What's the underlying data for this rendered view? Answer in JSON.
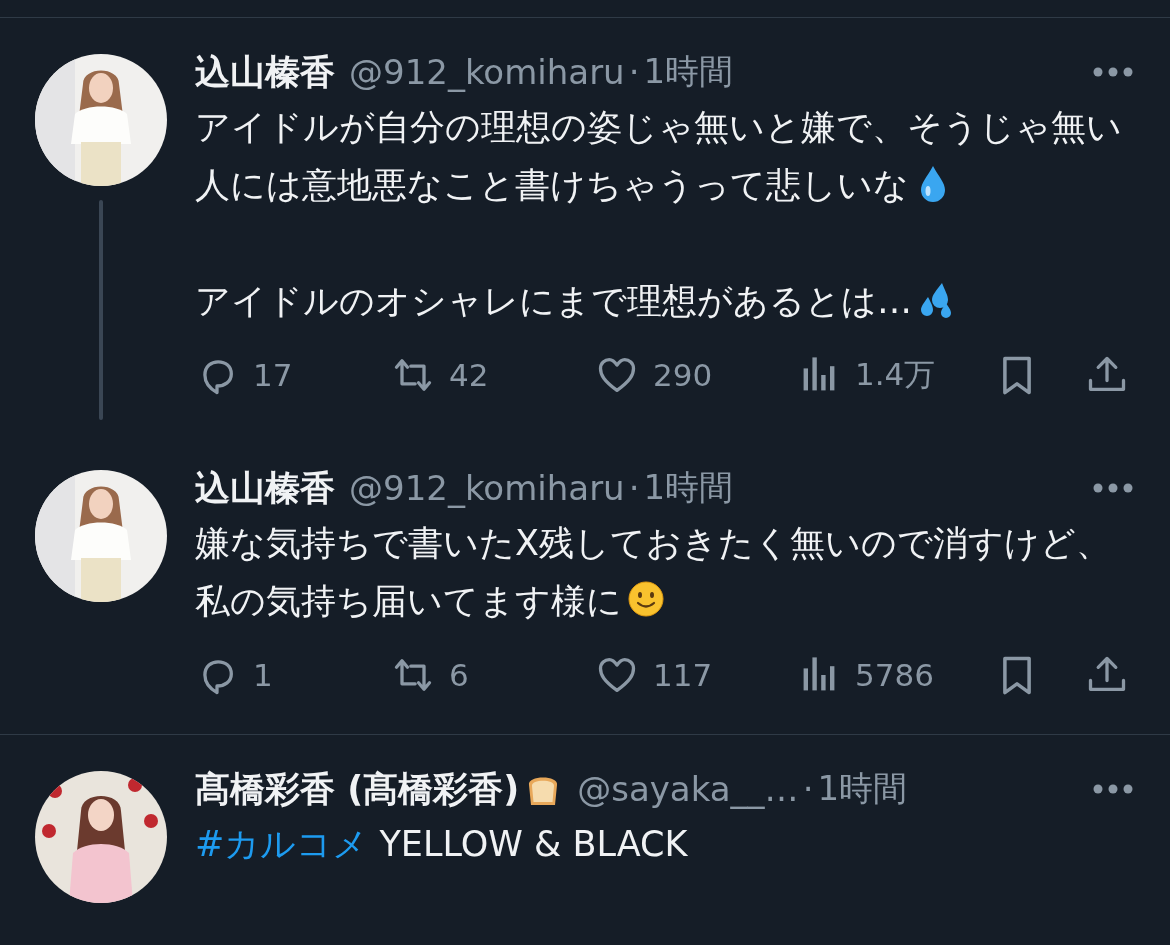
{
  "tweets": [
    {
      "name": "込山榛香",
      "handle": "@912_komiharu",
      "separator": "·",
      "time": "1時間",
      "thread_continues": true,
      "body": [
        {
          "segments": [
            {
              "kind": "text",
              "text": "アイドルが自分の理想の姿じゃ無いと嫌で、そうじゃ無い人には意地悪なこと書けちゃうって悲しいな"
            },
            {
              "kind": "droplet"
            }
          ]
        },
        {
          "segments": [
            {
              "kind": "text",
              "text": "アイドルのオシャレにまで理想があるとは…"
            },
            {
              "kind": "sweat"
            }
          ]
        }
      ],
      "stats": {
        "replies": "17",
        "reposts": "42",
        "likes": "290",
        "views": "1.4万"
      }
    },
    {
      "name": "込山榛香",
      "handle": "@912_komiharu",
      "separator": "·",
      "time": "1時間",
      "thread_continues": false,
      "body": [
        {
          "segments": [
            {
              "kind": "text",
              "text": "嫌な気持ちで書いたX残しておきたく無いので消すけど、私の気持ち届いてます様に"
            },
            {
              "kind": "smile"
            }
          ]
        }
      ],
      "stats": {
        "replies": "1",
        "reposts": "6",
        "likes": "117",
        "views": "5786"
      }
    },
    {
      "name": "髙橋彩香 (髙橋彩香)",
      "name_icon": {
        "kind": "bread"
      },
      "handle": "@sayaka__…",
      "separator": "·",
      "time": "1時間",
      "thread_continues": false,
      "body": [
        {
          "segments": [
            {
              "kind": "hashtag",
              "text": "#カルコメ"
            },
            {
              "kind": "text",
              "text": " YELLOW & BLACK"
            }
          ]
        }
      ]
    }
  ]
}
